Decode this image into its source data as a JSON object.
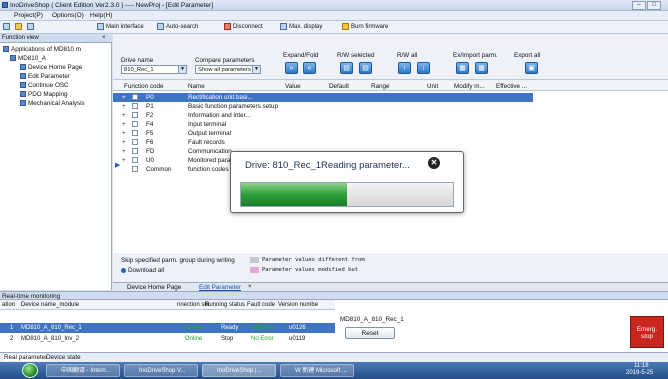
{
  "window": {
    "title": "InoDriveShop ( Client Edition Ver2.3.0 ) ---- NewProj - [Edit Parameter]",
    "controls": [
      "–",
      "□"
    ]
  },
  "menu": {
    "items": [
      "Project(P)",
      "Options(O)",
      "Help(H)"
    ]
  },
  "toolbar": {
    "main_interface": "Main interface",
    "auto_search": "Auto-search",
    "disconnect": "Disconnect",
    "max_display": "Max. display",
    "burn_firmware": "Burn firmware"
  },
  "left_panel": {
    "header": "Function view",
    "tree": [
      "Applications of MD810 m",
      "MD810_A",
      "Device Home Page",
      "Edit Parameter",
      "Continue OSC",
      "PDO Mapping",
      "Mechanical Analysis"
    ]
  },
  "param_header": {
    "drive_name_label": "Drive name",
    "drive_name_value": "810_Rec_1",
    "compare_label": "Compare parameters",
    "compare_value": "Show all parameters",
    "expand_fold": "Expand/Fold",
    "rw_selected": "R/W selected",
    "rw_all": "R/W all",
    "ex_import": "Ex/Import parm.",
    "export_all": "Export all"
  },
  "grid": {
    "columns": [
      "Function code",
      "Name",
      "Value",
      "Default",
      "Range",
      "Unit",
      "Modify m...",
      "Effective ..."
    ],
    "rows": [
      {
        "code": "P0",
        "name": "Rectification unit basi..."
      },
      {
        "code": "P1",
        "name": "Basic function parameters setup"
      },
      {
        "code": "F2",
        "name": "Information and inter..."
      },
      {
        "code": "F4",
        "name": "Input terminal"
      },
      {
        "code": "F5",
        "name": "Output terminal"
      },
      {
        "code": "F6",
        "name": "Fault records"
      },
      {
        "code": "FD",
        "name": "Communication"
      },
      {
        "code": "U0",
        "name": "Monitored para"
      },
      {
        "code": "Common",
        "name": "function codes"
      }
    ]
  },
  "bottom_options": {
    "skip_label": "Skip specified parm. group during writing",
    "download_all": "Download all",
    "legend_diff": "Parameter values different from",
    "legend_modified": "Parameter values modified but"
  },
  "modal": {
    "message": "Drive: 810_Rec_1Reading parameter...",
    "progress": 0.5
  },
  "doc_tabs": [
    "Device Home Page",
    "Edit Parameter"
  ],
  "monitor": {
    "title": "Real-time monitoring",
    "columns": [
      "ation",
      "Device name_module",
      "nnection sta",
      "Running status",
      "Fault code",
      "Version numbe"
    ],
    "rows": [
      {
        "index": "1",
        "device": "MD810_A_810_Rec_1",
        "connection": "Online",
        "running": "Ready",
        "fault": "No Error",
        "version": "u0126"
      },
      {
        "index": "2",
        "device": "MD810_A_810_Inv_2",
        "connection": "Online",
        "running": "Stop",
        "fault": "No Error",
        "version": "u0119"
      }
    ],
    "selected_device": "MD810_A_810_Rec_1",
    "reset": "Reset",
    "emergency": "Emerg. stop"
  },
  "bottom_tabs": [
    "Real parameter",
    "Device state"
  ],
  "taskbar": {
    "items": [
      "中国翻译 - Intern...",
      "InoDriveShop V...",
      "InoDriveShop |...",
      "W 新建 Microsoft ..."
    ],
    "time": "11:18",
    "date": "2019-5-25"
  },
  "colors": {
    "emergency": "#c8261f",
    "selected_row": "#3f74c4",
    "progress_green": "#2f9e3a",
    "online": "#22a52a"
  }
}
